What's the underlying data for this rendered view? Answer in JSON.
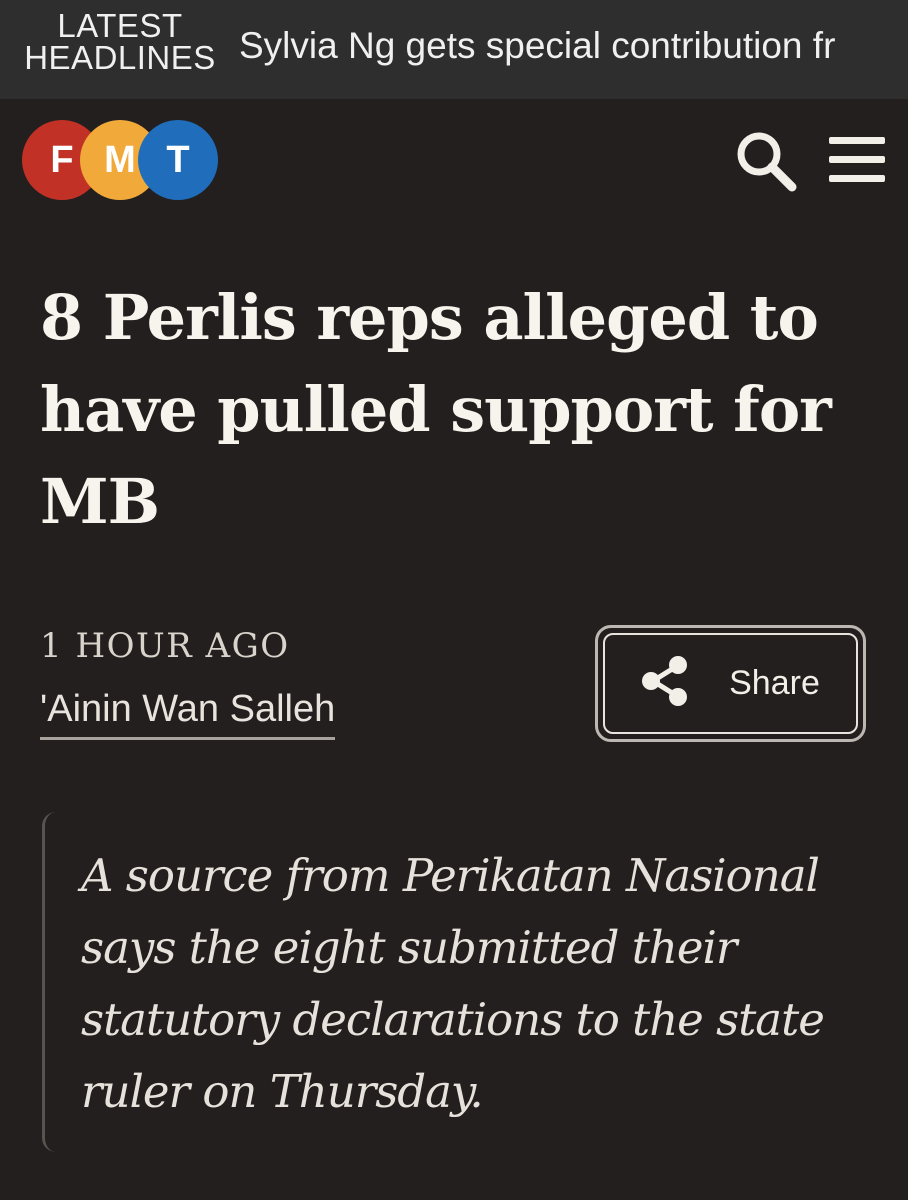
{
  "ticker": {
    "label_line1": "LATEST",
    "label_line2": "HEADLINES",
    "text": "Sylvia Ng gets special contribution fr"
  },
  "logo": {
    "letters": [
      "F",
      "M",
      "T"
    ]
  },
  "icons": {
    "search": "search-icon",
    "menu": "hamburger-menu-icon",
    "share": "share-icon"
  },
  "colors": {
    "logo_red": "#c23126",
    "logo_orange": "#f1a93a",
    "logo_blue": "#1f6dbb",
    "background": "#231f1e"
  },
  "article": {
    "headline": "8 Perlis reps alleged to have pulled support for MB",
    "time": "1 HOUR AGO",
    "author": "'Ainin Wan Salleh",
    "share_label": "Share",
    "summary": "A source from Perikatan Nasional says the eight submitted their statutory declarations to the state ruler on Thursday."
  }
}
